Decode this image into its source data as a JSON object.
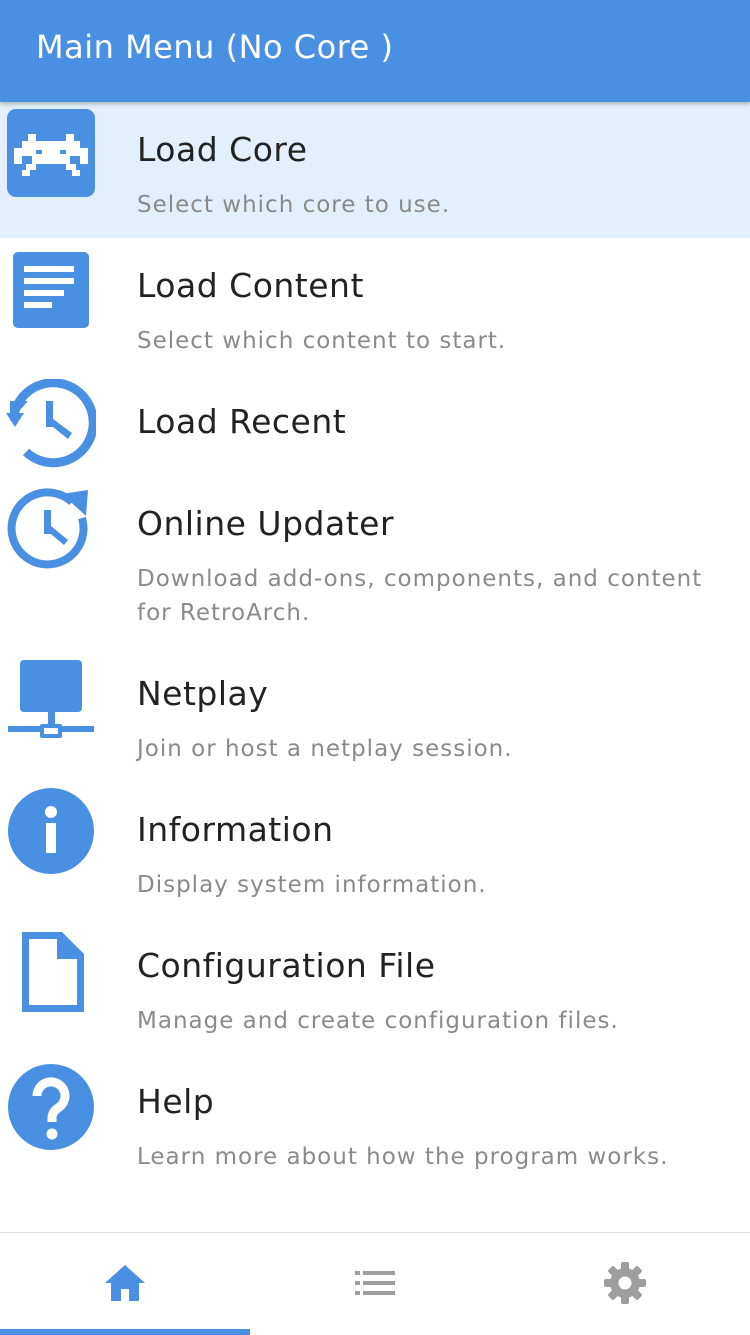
{
  "header": {
    "title": "Main Menu (No Core )"
  },
  "colors": {
    "accent": "#4a90e2",
    "selected_bg": "#e3effa",
    "label": "#222222",
    "sublabel": "#8a8a8a",
    "tab_inactive": "#9e9e9e"
  },
  "menu": {
    "items": [
      {
        "icon": "retroarch-invader-icon",
        "label": "Load Core",
        "sublabel": "Select which core to use.",
        "selected": true
      },
      {
        "icon": "document-lines-icon",
        "label": "Load Content",
        "sublabel": "Select which content to start."
      },
      {
        "icon": "history-clock-icon",
        "label": "Load Recent",
        "sublabel": ""
      },
      {
        "icon": "update-clock-icon",
        "label": "Online Updater",
        "sublabel": "Download add-ons, components, and content for RetroArch."
      },
      {
        "icon": "network-monitor-icon",
        "label": "Netplay",
        "sublabel": "Join or host a netplay session."
      },
      {
        "icon": "info-icon",
        "label": "Information",
        "sublabel": "Display system information."
      },
      {
        "icon": "file-icon",
        "label": "Configuration File",
        "sublabel": "Manage and create configuration files."
      },
      {
        "icon": "help-icon",
        "label": "Help",
        "sublabel": "Learn more about how the program works."
      }
    ]
  },
  "tabbar": {
    "tabs": [
      {
        "icon": "home-icon",
        "active": true
      },
      {
        "icon": "list-icon",
        "active": false
      },
      {
        "icon": "gear-icon",
        "active": false
      }
    ]
  }
}
